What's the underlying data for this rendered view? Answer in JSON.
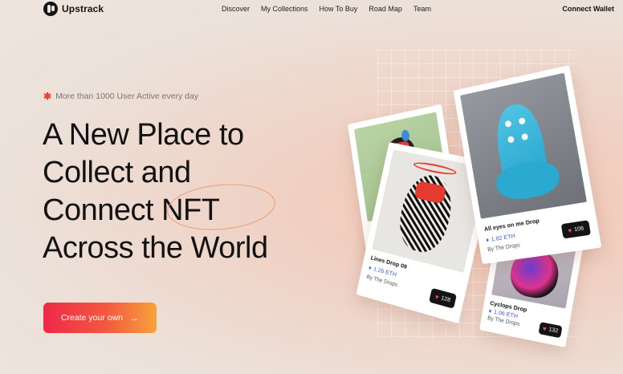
{
  "brand": {
    "name": "Upstrack"
  },
  "nav": {
    "links": [
      "Discover",
      "My Collections",
      "How To Buy",
      "Road Map",
      "Team"
    ],
    "connect_label": "Connect Wallet"
  },
  "hero": {
    "tagline": "More than 1000 User Active every day",
    "headline_lines": [
      "A New Place to",
      "Collect and",
      "Connect NFT",
      "Across the World"
    ],
    "cta_label": "Create your own",
    "cta_arrow": "→"
  },
  "cards": [
    {
      "title": "Lines Drop 09",
      "price": "1.26 ETH",
      "by": "By The Drops",
      "likes": "128"
    },
    {
      "title": "All eyes on me Drop",
      "price": "1.82 ETH",
      "by": "By The Drops",
      "likes": "106"
    },
    {
      "title": "Cyclops Drop",
      "price": "1.06 ETH",
      "by": "By The Drops",
      "likes": "132"
    }
  ],
  "colors": {
    "accent": "#f23b36",
    "eth_price": "#3b5bdb",
    "cta_start": "#f0284a",
    "cta_end": "#f6a23c"
  }
}
